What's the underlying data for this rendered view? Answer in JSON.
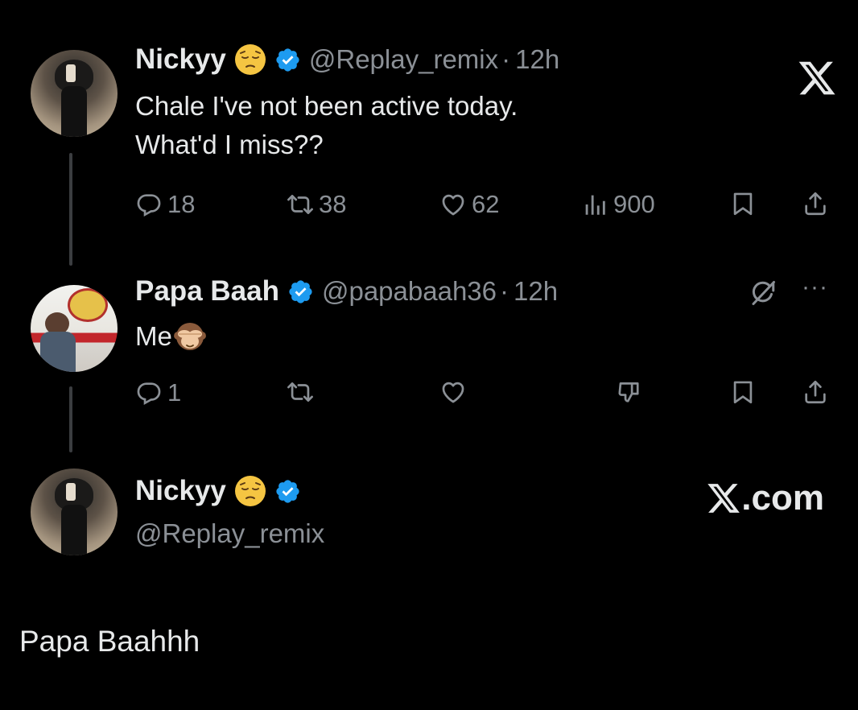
{
  "tweet1": {
    "name": "Nickyy",
    "handle": "@Replay_remix",
    "dot": "·",
    "time": "12h",
    "text_line1": "Chale I've not been active today.",
    "text_line2": "What'd I miss??",
    "replies": "18",
    "reposts": "38",
    "likes": "62",
    "views": "900"
  },
  "tweet2": {
    "name": "Papa Baah",
    "handle": "@papabaah36",
    "dot": "·",
    "time": "12h",
    "text": "Me",
    "replies": "1",
    "more": "···"
  },
  "tweet3": {
    "name": "Nickyy",
    "handle": "@Replay_remix"
  },
  "brand": {
    "xcom": ".com"
  },
  "footer": {
    "text": "Papa Baahhh"
  },
  "colors": {
    "background": "#000000",
    "verified": "#1d9bf0",
    "muted": "#8b9096"
  },
  "icons": [
    "x-logo-icon",
    "verified-badge-icon",
    "reply-icon",
    "repost-icon",
    "like-icon",
    "views-icon",
    "bookmark-icon",
    "share-icon",
    "grok-icon",
    "more-icon",
    "downvote-icon",
    "pensive-emoji",
    "see-no-evil-emoji"
  ]
}
